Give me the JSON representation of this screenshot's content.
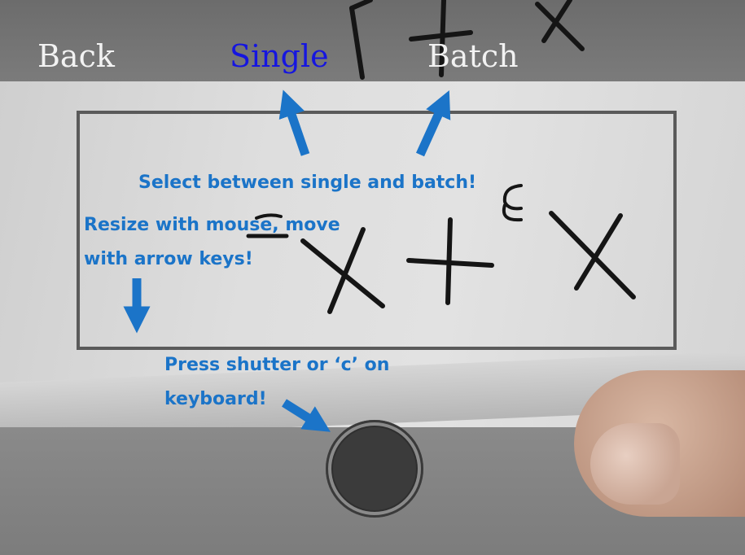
{
  "nav": {
    "back_label": "Back",
    "single_label": "Single",
    "batch_label": "Batch"
  },
  "colors": {
    "single_active": "#1515e0",
    "nav_inactive": "#f2f2f2",
    "annotation": "#1b74c8"
  },
  "annotations": {
    "select_mode": "Select between single and batch!",
    "resize_line1": "Resize with mouse, move",
    "resize_line2": "with arrow keys!",
    "press_line1": "Press shutter or ‘c’ on",
    "press_line2": "keyboard!"
  },
  "icons": {
    "shutter": "shutter-button-icon",
    "arrows": "arrow-icon"
  }
}
